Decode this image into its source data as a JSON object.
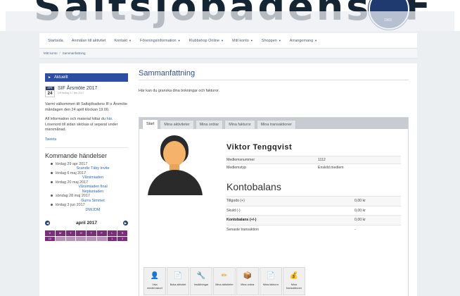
{
  "site": {
    "logo_text": "Saltsjöbadens IF",
    "crest_year": "1906"
  },
  "nav": {
    "items": [
      {
        "label": "Startsida",
        "dropdown": false
      },
      {
        "label": "Anmälan till aktivitet",
        "dropdown": false
      },
      {
        "label": "Kontakt",
        "dropdown": true
      },
      {
        "label": "Föreningsinformation",
        "dropdown": true
      },
      {
        "label": "Klubbshop Online",
        "dropdown": true
      },
      {
        "label": "Mitt konto",
        "dropdown": true
      },
      {
        "label": "Shoppen",
        "dropdown": true
      },
      {
        "label": "Arrangemang",
        "dropdown": true
      }
    ],
    "caret": "▼"
  },
  "breadcrumb": {
    "items": [
      "Mitt konto",
      "Sammanfattning"
    ],
    "separator": "/"
  },
  "sidebar": {
    "aktuellt_label": "Aktuellt",
    "news": {
      "badge_month": "APR",
      "badge_day": "24",
      "title": "SIF Årsmöte 2017",
      "subtitle": "Ulf fredag 17 feb 2017",
      "paragraph1": "Varmt välkommen till Saltsjöbadens IF:s Årsmöte måndagen den 24 april klockan 19.00.",
      "paragraph2_prefix": "All information och material hittar du ",
      "paragraph2_link": "här",
      "paragraph2_suffix": ". Lösenord till sidan skickas ut separat under marsmånad.",
      "tweet_label": "Tweeta"
    },
    "events_title": "Kommande händelser",
    "events": [
      {
        "date": "lördag 29 apr 2017",
        "names": [
          "Scandic Täby Invite"
        ]
      },
      {
        "date": "lördag 6 maj 2017",
        "names": [
          "Vårsimiaden"
        ]
      },
      {
        "date": "lördag 20 maj 2017",
        "names": [
          "Vårsimiaden final",
          "Neptuniaden"
        ]
      },
      {
        "date": "söndag 28 maj 2017",
        "names": [
          "Gurra Simmet"
        ]
      },
      {
        "date": "lördag 3 jun 2017",
        "names": [
          "DM/JDM"
        ]
      }
    ],
    "calendar": {
      "prev": "◀",
      "next": "▶",
      "month": "april 2017",
      "days": [
        "V",
        "M",
        "T",
        "O",
        "T",
        "F",
        "L",
        "S"
      ],
      "first_row": [
        "13",
        "",
        "",
        "",
        "",
        "",
        "1",
        "2"
      ]
    }
  },
  "content": {
    "title": "Sammanfattning",
    "intro": "Här kan du granska dina bokningar och fakturor.",
    "tabs": [
      "Start",
      "Mina aktiviteter",
      "Mina ordrar",
      "Mina fakturor",
      "Mina transaktioner"
    ],
    "member_name": "Viktor Tengqvist",
    "info": [
      {
        "label": "Medlemsnummer",
        "value": "1112"
      },
      {
        "label": "Medlemstyp",
        "value": "Enskild medlem"
      }
    ],
    "kontobalans_title": "Kontobalans",
    "balance": [
      {
        "label": "Tillgodo (+)",
        "value": "0,00 kr"
      },
      {
        "label": "Skuld (-)",
        "value": "0,00 kr"
      },
      {
        "label": "Kontobalans (+/-)",
        "value": "0,00 kr"
      },
      {
        "label": "Senaste transaktion",
        "value": "-"
      }
    ],
    "tools": [
      {
        "label": "Visa medlemskort",
        "icon": "member-card-icon",
        "glyph": "👤",
        "color": "#c0392b"
      },
      {
        "label": "Boka aktivitet",
        "icon": "book-activity-icon",
        "glyph": "📄",
        "color": "#d4a017"
      },
      {
        "label": "Inställningar",
        "icon": "settings-icon",
        "glyph": "🔧",
        "color": "#7f8c8d"
      },
      {
        "label": "Mina aktiviteter",
        "icon": "activities-icon",
        "glyph": "✏",
        "color": "#d4a017"
      },
      {
        "label": "Mina ordrar",
        "icon": "orders-icon",
        "glyph": "📦",
        "color": "#5d6d7e"
      },
      {
        "label": "Mina fakturor",
        "icon": "invoice-icon",
        "glyph": "📄",
        "color": "#5d6d7e"
      },
      {
        "label": "Mina transaktioner",
        "icon": "transactions-icon",
        "glyph": "💰",
        "color": "#27ae60"
      }
    ]
  }
}
